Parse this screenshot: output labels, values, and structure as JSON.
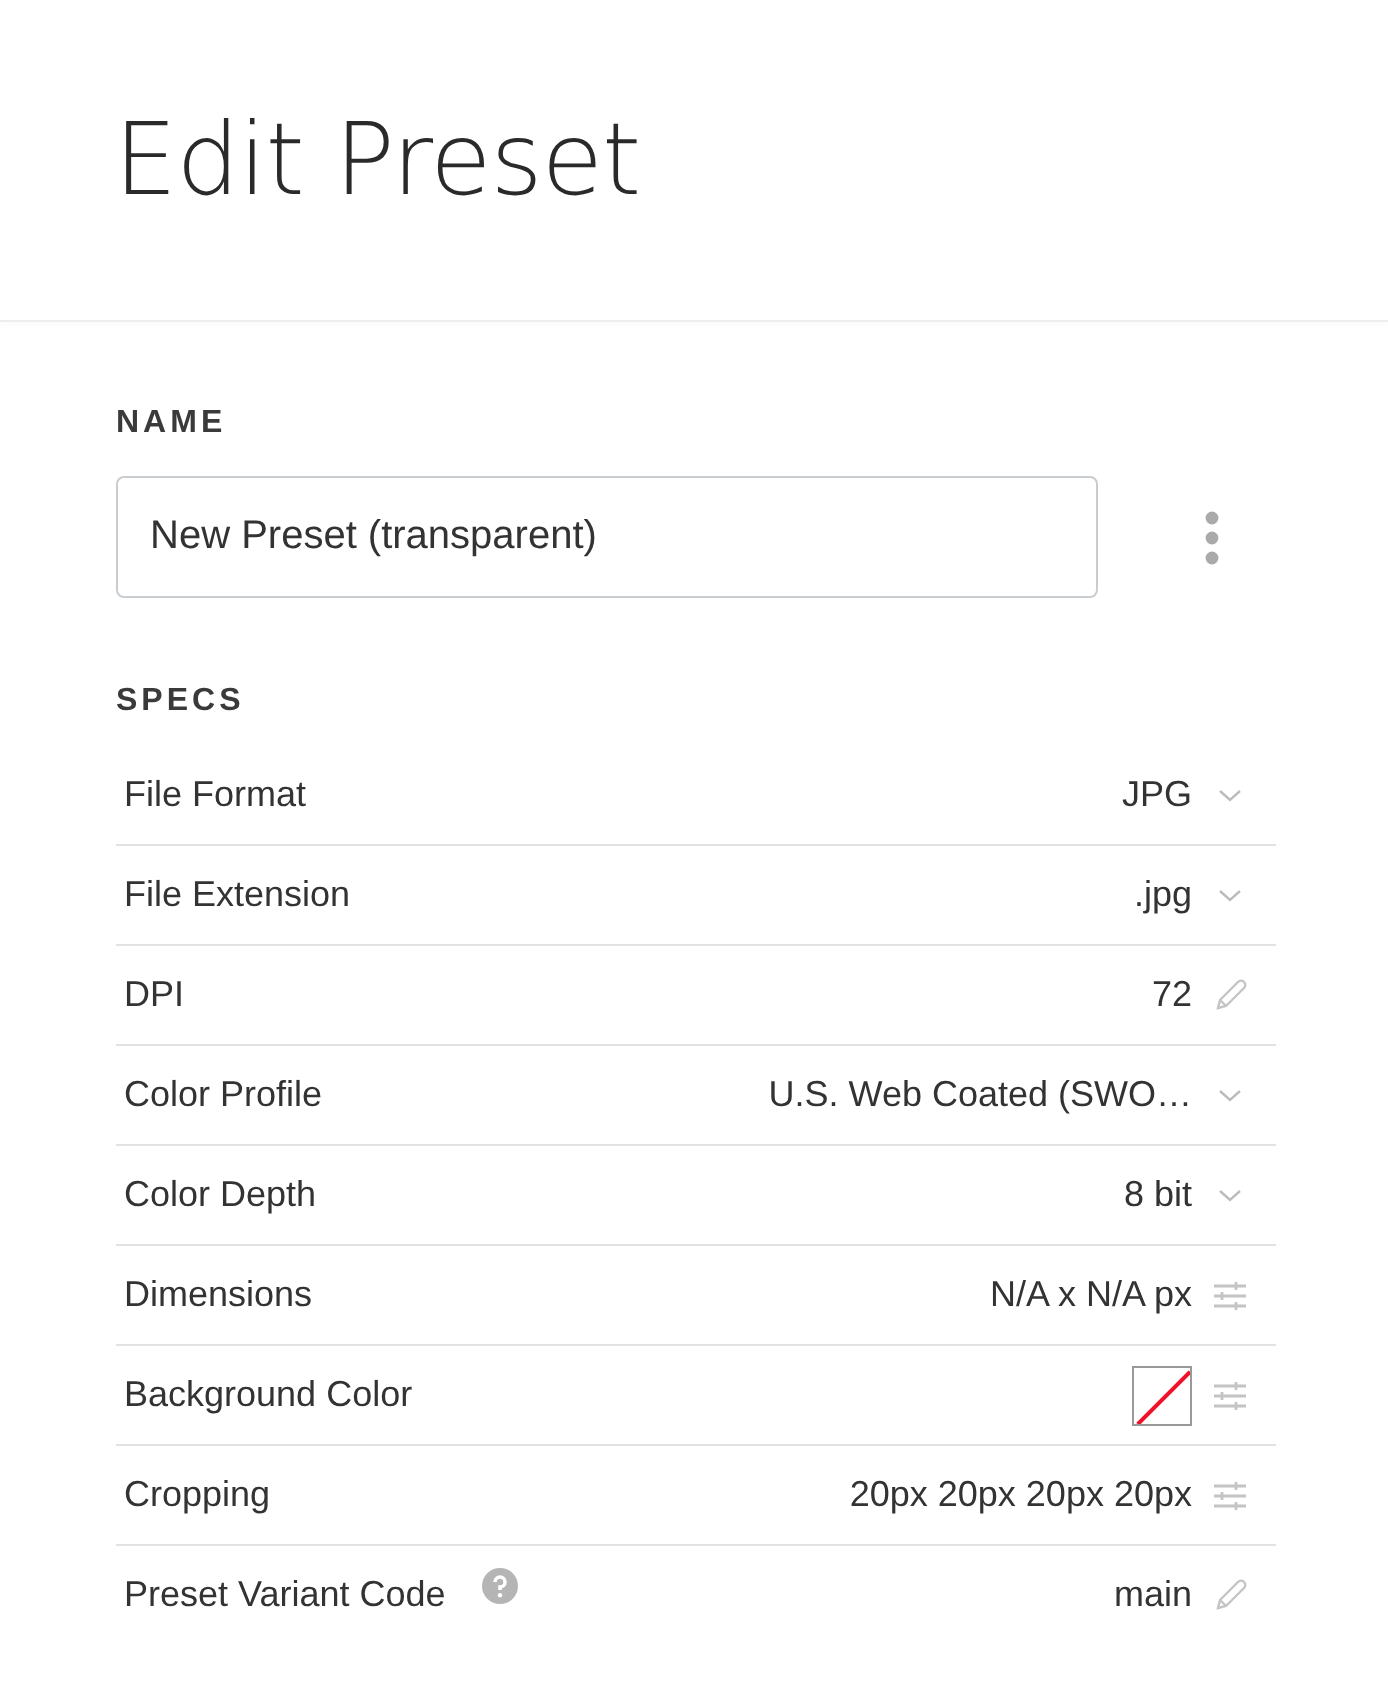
{
  "title": "Edit Preset",
  "name_section": {
    "label": "NAME",
    "value": "New Preset (transparent)"
  },
  "specs": {
    "label": "SPECS",
    "rows": [
      {
        "label": "File Format",
        "value": "JPG",
        "kind": "dropdown"
      },
      {
        "label": "File Extension",
        "value": ".jpg",
        "kind": "dropdown"
      },
      {
        "label": "DPI",
        "value": "72",
        "kind": "edit"
      },
      {
        "label": "Color Profile",
        "value": "U.S. Web Coated (SWO…",
        "kind": "dropdown"
      },
      {
        "label": "Color Depth",
        "value": "8 bit",
        "kind": "dropdown"
      },
      {
        "label": "Dimensions",
        "value": "N/A x N/A px",
        "kind": "adjust"
      },
      {
        "label": "Background Color",
        "kind": "swatch",
        "transparent": true
      },
      {
        "label": "Cropping",
        "value": "20px 20px 20px 20px",
        "kind": "adjust"
      },
      {
        "label": "Preset Variant Code",
        "value": "main",
        "kind": "edit",
        "help": true
      }
    ]
  }
}
